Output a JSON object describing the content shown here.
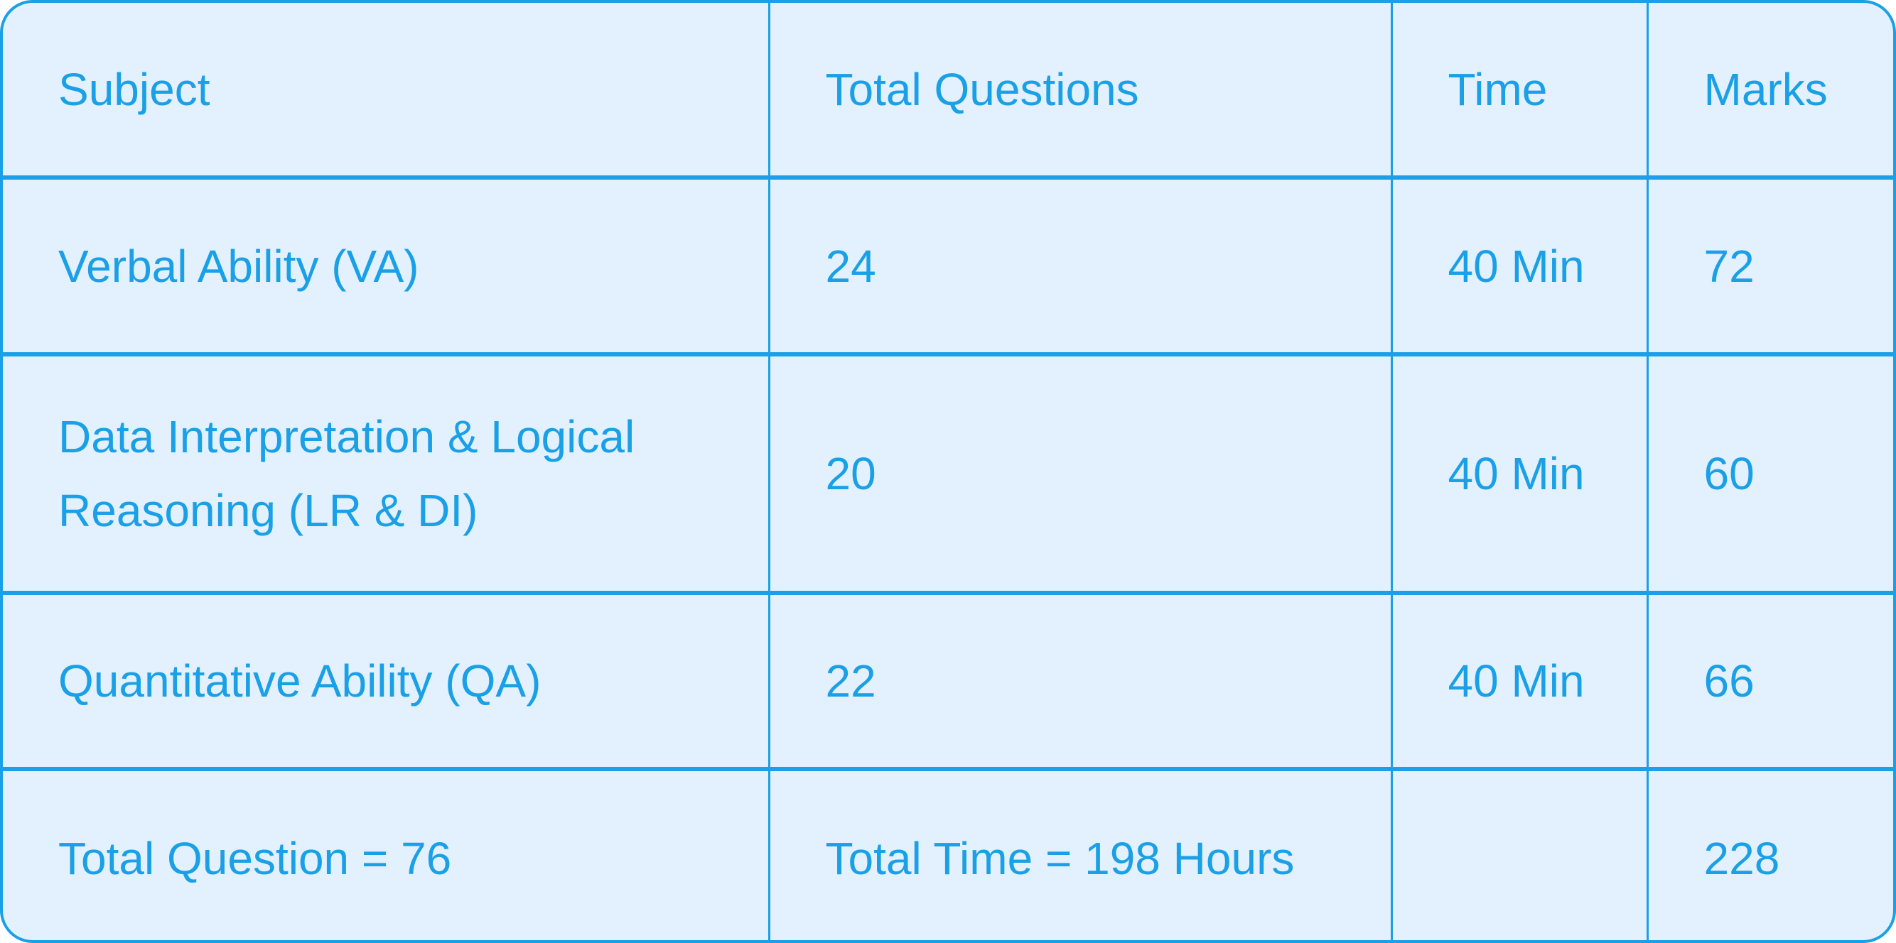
{
  "table": {
    "headers": [
      "Subject",
      "Total Questions",
      "Time",
      "Marks"
    ],
    "rows": [
      [
        "Verbal Ability (VA)",
        "24",
        "40 Min",
        "72"
      ],
      [
        "Data Interpretation & Logical Reasoning (LR & DI)",
        "20",
        "40 Min",
        "60"
      ],
      [
        "Quantitative Ability (QA)",
        "22",
        "40 Min",
        "66"
      ]
    ],
    "footer": [
      "Total Question = 76",
      "Total Time = 198 Hours",
      "",
      "228"
    ]
  },
  "colors": {
    "accent": "#1aa0e6",
    "background": "#e3f0fd"
  }
}
